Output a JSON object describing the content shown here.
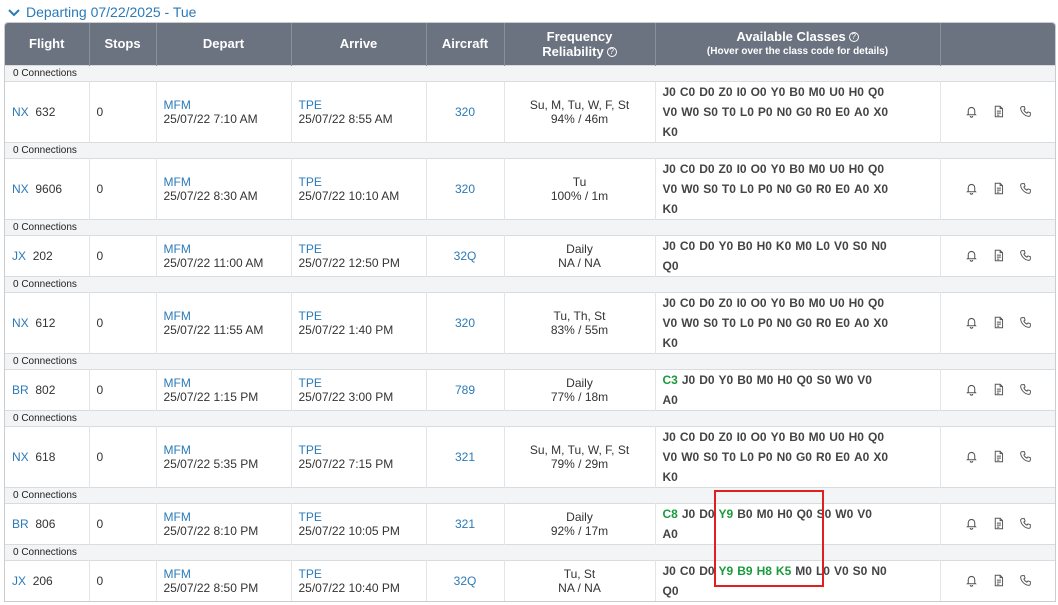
{
  "section": {
    "title": "Departing 07/22/2025 - Tue"
  },
  "headers": {
    "flight": "Flight",
    "stops": "Stops",
    "depart": "Depart",
    "arrive": "Arrive",
    "aircraft": "Aircraft",
    "freq_line1": "Frequency",
    "freq_line2": "Reliability",
    "classes": "Available Classes",
    "classes_sub": "(Hover over the class code for details)"
  },
  "colors": {
    "header_bg": "#6b7280",
    "link": "#2a7ab8",
    "available": "#1a9a3c",
    "highlight": "#e02020"
  },
  "flights": [
    {
      "connections": "0 Connections",
      "airline": "NX",
      "number": "632",
      "stops": "0",
      "dep_code": "MFM",
      "dep_time": "25/07/22 7:10 AM",
      "arr_code": "TPE",
      "arr_time": "25/07/22 8:55 AM",
      "aircraft": "320",
      "frequency": "Su, M, Tu, W, F, St",
      "reliability": "94% / 46m",
      "classes": [
        [
          "J0",
          "C0",
          "D0",
          "Z0",
          "I0",
          "O0",
          "Y0",
          "B0",
          "M0",
          "U0",
          "H0",
          "Q0"
        ],
        [
          "V0",
          "W0",
          "S0",
          "T0",
          "L0",
          "P0",
          "N0",
          "G0",
          "R0",
          "E0",
          "A0",
          "X0"
        ],
        [
          "K0"
        ]
      ],
      "available": []
    },
    {
      "connections": "0 Connections",
      "airline": "NX",
      "number": "9606",
      "stops": "0",
      "dep_code": "MFM",
      "dep_time": "25/07/22 8:30 AM",
      "arr_code": "TPE",
      "arr_time": "25/07/22 10:10 AM",
      "aircraft": "320",
      "frequency": "Tu",
      "reliability": "100% / 1m",
      "classes": [
        [
          "J0",
          "C0",
          "D0",
          "Z0",
          "I0",
          "O0",
          "Y0",
          "B0",
          "M0",
          "U0",
          "H0",
          "Q0"
        ],
        [
          "V0",
          "W0",
          "S0",
          "T0",
          "L0",
          "P0",
          "N0",
          "G0",
          "R0",
          "E0",
          "A0",
          "X0"
        ],
        [
          "K0"
        ]
      ],
      "available": []
    },
    {
      "connections": "0 Connections",
      "airline": "JX",
      "number": "202",
      "stops": "0",
      "dep_code": "MFM",
      "dep_time": "25/07/22 11:00 AM",
      "arr_code": "TPE",
      "arr_time": "25/07/22 12:50 PM",
      "aircraft": "32Q",
      "frequency": "Daily",
      "reliability": "NA / NA",
      "classes": [
        [
          "J0",
          "C0",
          "D0",
          "Y0",
          "B0",
          "H0",
          "K0",
          "M0",
          "L0",
          "V0",
          "S0",
          "N0"
        ],
        [
          "Q0"
        ]
      ],
      "available": []
    },
    {
      "connections": "0 Connections",
      "airline": "NX",
      "number": "612",
      "stops": "0",
      "dep_code": "MFM",
      "dep_time": "25/07/22 11:55 AM",
      "arr_code": "TPE",
      "arr_time": "25/07/22 1:40 PM",
      "aircraft": "320",
      "frequency": "Tu, Th, St",
      "reliability": "83% / 55m",
      "classes": [
        [
          "J0",
          "C0",
          "D0",
          "Z0",
          "I0",
          "O0",
          "Y0",
          "B0",
          "M0",
          "U0",
          "H0",
          "Q0"
        ],
        [
          "V0",
          "W0",
          "S0",
          "T0",
          "L0",
          "P0",
          "N0",
          "G0",
          "R0",
          "E0",
          "A0",
          "X0"
        ],
        [
          "K0"
        ]
      ],
      "available": []
    },
    {
      "connections": "0 Connections",
      "airline": "BR",
      "number": "802",
      "stops": "0",
      "dep_code": "MFM",
      "dep_time": "25/07/22 1:15 PM",
      "arr_code": "TPE",
      "arr_time": "25/07/22 3:00 PM",
      "aircraft": "789",
      "frequency": "Daily",
      "reliability": "77% / 18m",
      "classes": [
        [
          "C3",
          "J0",
          "D0",
          "Y0",
          "B0",
          "M0",
          "H0",
          "Q0",
          "S0",
          "W0",
          "V0"
        ],
        [
          "A0"
        ]
      ],
      "available": [
        "C3"
      ]
    },
    {
      "connections": "0 Connections",
      "airline": "NX",
      "number": "618",
      "stops": "0",
      "dep_code": "MFM",
      "dep_time": "25/07/22 5:35 PM",
      "arr_code": "TPE",
      "arr_time": "25/07/22 7:15 PM",
      "aircraft": "321",
      "frequency": "Su, M, Tu, W, F, St",
      "reliability": "79% / 29m",
      "classes": [
        [
          "J0",
          "C0",
          "D0",
          "Z0",
          "I0",
          "O0",
          "Y0",
          "B0",
          "M0",
          "U0",
          "H0",
          "Q0"
        ],
        [
          "V0",
          "W0",
          "S0",
          "T0",
          "L0",
          "P0",
          "N0",
          "G0",
          "R0",
          "E0",
          "A0",
          "X0"
        ],
        [
          "K0"
        ]
      ],
      "available": []
    },
    {
      "connections": "0 Connections",
      "airline": "BR",
      "number": "806",
      "stops": "0",
      "dep_code": "MFM",
      "dep_time": "25/07/22 8:10 PM",
      "arr_code": "TPE",
      "arr_time": "25/07/22 10:05 PM",
      "aircraft": "321",
      "frequency": "Daily",
      "reliability": "92% / 17m",
      "classes": [
        [
          "C8",
          "J0",
          "D0",
          "Y9",
          "B0",
          "M0",
          "H0",
          "Q0",
          "S0",
          "W0",
          "V0"
        ],
        [
          "A0"
        ]
      ],
      "available": [
        "C8",
        "Y9"
      ]
    },
    {
      "connections": "0 Connections",
      "airline": "JX",
      "number": "206",
      "stops": "0",
      "dep_code": "MFM",
      "dep_time": "25/07/22 8:50 PM",
      "arr_code": "TPE",
      "arr_time": "25/07/22 10:40 PM",
      "aircraft": "32Q",
      "frequency": "Tu, St",
      "reliability": "NA / NA",
      "classes": [
        [
          "J0",
          "C0",
          "D0",
          "Y9",
          "B9",
          "H8",
          "K5",
          "M0",
          "L0",
          "V0",
          "S0",
          "N0"
        ],
        [
          "Q0"
        ]
      ],
      "available": [
        "Y9",
        "B9",
        "H8",
        "K5"
      ]
    }
  ]
}
